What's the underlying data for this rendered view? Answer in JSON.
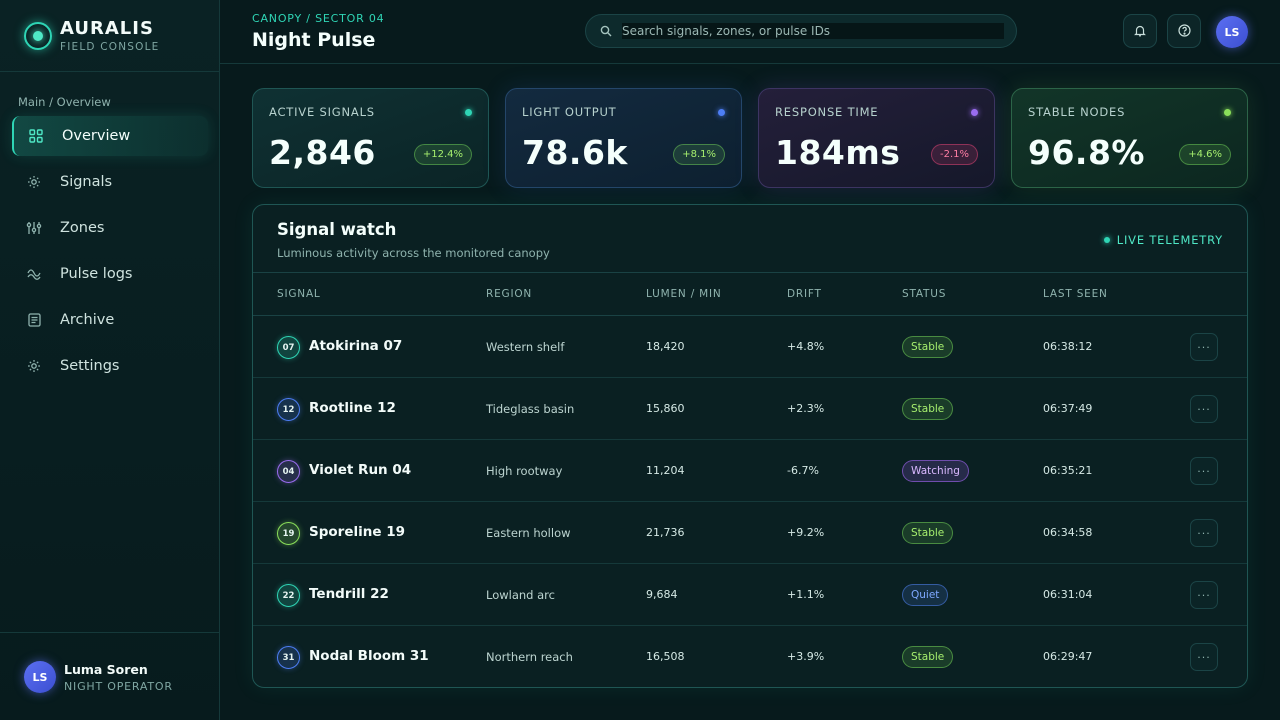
{
  "brand": {
    "name": "AURALIS",
    "subtitle": "FIELD CONSOLE"
  },
  "sidebar": {
    "section": "Main / Overview",
    "items": [
      {
        "label": "Overview",
        "icon": "grid-icon",
        "active": true
      },
      {
        "label": "Signals",
        "icon": "signal-icon",
        "active": false
      },
      {
        "label": "Zones",
        "icon": "sliders-icon",
        "active": false
      },
      {
        "label": "Pulse logs",
        "icon": "pulse-icon",
        "active": false
      },
      {
        "label": "Archive",
        "icon": "archive-icon",
        "active": false
      },
      {
        "label": "Settings",
        "icon": "gear-icon",
        "active": false
      }
    ],
    "user": {
      "initials": "LS",
      "name": "Luma Soren",
      "role": "NIGHT OPERATOR"
    }
  },
  "header": {
    "breadcrumb": "CANOPY / SECTOR 04",
    "title": "Night Pulse",
    "search_placeholder": "Search signals, zones, or pulse IDs",
    "avatar_initials": "LS"
  },
  "kpis": [
    {
      "label": "ACTIVE SIGNALS",
      "value": "2,846",
      "delta": "+12.4%",
      "trend": "up",
      "dot_color": "#2fd5b5"
    },
    {
      "label": "LIGHT OUTPUT",
      "value": "78.6k",
      "delta": "+8.1%",
      "trend": "up",
      "dot_color": "#4d7ef5"
    },
    {
      "label": "RESPONSE TIME",
      "value": "184ms",
      "delta": "-2.1%",
      "trend": "down",
      "dot_color": "#9a6cf0"
    },
    {
      "label": "STABLE NODES",
      "value": "96.8%",
      "delta": "+4.6%",
      "trend": "up",
      "dot_color": "#8be05a"
    }
  ],
  "panel": {
    "title": "Signal watch",
    "subtitle": "Luminous activity across the monitored canopy",
    "live_label": "LIVE TELEMETRY",
    "columns": [
      "SIGNAL",
      "REGION",
      "LUMEN / MIN",
      "DRIFT",
      "STATUS",
      "LAST SEEN"
    ],
    "rows": [
      {
        "id": "07",
        "name": "Atokirina 07",
        "region": "Western shelf",
        "lumen": "18,420",
        "drift": "+4.8%",
        "status": "Stable",
        "last_seen": "06:38:12",
        "icon_color": "#2fd5b5"
      },
      {
        "id": "12",
        "name": "Rootline 12",
        "region": "Tideglass basin",
        "lumen": "15,860",
        "drift": "+2.3%",
        "status": "Stable",
        "last_seen": "06:37:49",
        "icon_color": "#4d7ef5"
      },
      {
        "id": "04",
        "name": "Violet Run 04",
        "region": "High rootway",
        "lumen": "11,204",
        "drift": "-6.7%",
        "status": "Watching",
        "last_seen": "06:35:21",
        "icon_color": "#9a6cf0"
      },
      {
        "id": "19",
        "name": "Sporeline 19",
        "region": "Eastern hollow",
        "lumen": "21,736",
        "drift": "+9.2%",
        "status": "Stable",
        "last_seen": "06:34:58",
        "icon_color": "#8be05a"
      },
      {
        "id": "22",
        "name": "Tendrill 22",
        "region": "Lowland arc",
        "lumen": "9,684",
        "drift": "+1.1%",
        "status": "Quiet",
        "last_seen": "06:31:04",
        "icon_color": "#2fd5b5"
      },
      {
        "id": "31",
        "name": "Nodal Bloom 31",
        "region": "Northern reach",
        "lumen": "16,508",
        "drift": "+3.9%",
        "status": "Stable",
        "last_seen": "06:29:47",
        "icon_color": "#4d7ef5"
      }
    ]
  }
}
